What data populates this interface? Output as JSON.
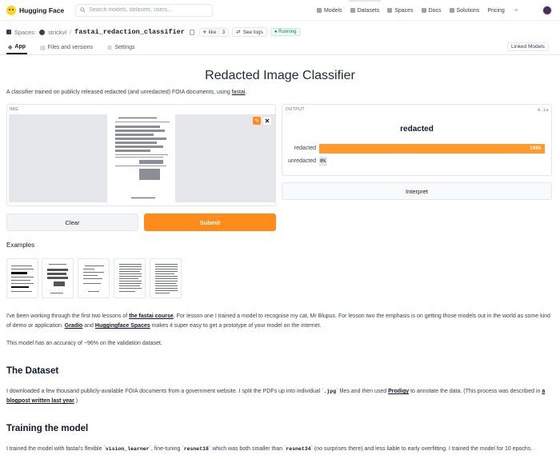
{
  "nav": {
    "brand": "Hugging Face",
    "search_placeholder": "Search models, datasets, users...",
    "links": [
      {
        "label": "Models",
        "icon": "models-icon"
      },
      {
        "label": "Datasets",
        "icon": "datasets-icon"
      },
      {
        "label": "Spaces",
        "icon": "spaces-icon"
      },
      {
        "label": "Docs",
        "icon": "docs-icon"
      },
      {
        "label": "Solutions",
        "icon": "solutions-icon"
      },
      {
        "label": "Pricing",
        "icon": ""
      }
    ]
  },
  "space": {
    "prefix": "Spaces:",
    "owner": "strickvl",
    "separator": "/",
    "name": "fastai_redaction_classifier",
    "like_label": "like",
    "like_count": "3",
    "see_logs": "See logs",
    "status": "Running",
    "linked_models": "Linked Models"
  },
  "tabs": [
    {
      "label": "App"
    },
    {
      "label": "Files and versions"
    },
    {
      "label": "Settings"
    }
  ],
  "app": {
    "title": "Redacted Image Classifier",
    "description_pre": "A classifier trained on publicly released redacted (and unredacted) FOIA documents, using ",
    "description_link": "fastai",
    "description_post": ".",
    "input_label": "IMG",
    "output_label": "OUTPUT",
    "output_time": "0.1s",
    "predicted_label": "redacted",
    "confidences": [
      {
        "label": "redacted",
        "value": 1.0,
        "text": "100%"
      },
      {
        "label": "unredacted",
        "value": 0.0,
        "text": "0%"
      }
    ],
    "clear_label": "Clear",
    "submit_label": "Submit",
    "interpret_label": "Interpret",
    "examples_heading": "Examples"
  },
  "article": {
    "p1_a": "I've been working through the first two lessons of ",
    "p1_link1": "the fastai course",
    "p1_b": ". For lesson one I trained a model to recognise my cat, Mr Blupus. For lesson two the emphasis is on getting those models out in the world as some kind of demo or application. ",
    "p1_link2": "Gradio",
    "p1_c": " and ",
    "p1_link3": "Huggingface Spaces",
    "p1_d": " makes it super easy to get a prototype of your model on the internet.",
    "p2": "This model has an accuracy of ~96% on the validation dataset.",
    "h_dataset": "The Dataset",
    "p3_a": "I downloaded a few thousand publicly-available FOIA documents from a government website. I split the PDFs up into individual `",
    "p3_code": ".jpg",
    "p3_b": "` files and then used ",
    "p3_link1": "Prodigy",
    "p3_c": " to annotate the data. (This process was described in ",
    "p3_link2": "a blogpost written last year",
    "p3_d": ".)",
    "h_training": "Training the model",
    "p4_a": "I trained the model with fastai's flexible `",
    "p4_code1": "vision_learner",
    "p4_b": "`, fine-tuning `",
    "p4_code2": "resnet18",
    "p4_c": "` which was both smaller than `",
    "p4_code3": "resnet34",
    "p4_d": "` (no surprises there) and less liable to early overfitting. I trained the model for 10 epochs."
  },
  "colors": {
    "accent": "#ff8c1a",
    "running": "#15803d"
  }
}
